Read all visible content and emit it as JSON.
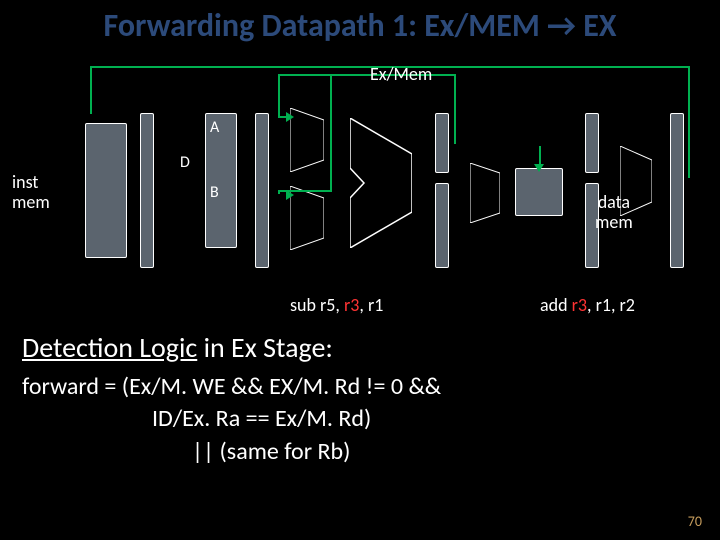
{
  "title": "Forwarding Datapath 1: Ex/MEM → EX",
  "diagram": {
    "exmem_label": "Ex/Mem",
    "inst_mem": "inst\nmem",
    "data_mem": "data\nmem",
    "port_d": "D",
    "port_a": "A",
    "port_b": "B",
    "sub_text": "sub r5, ",
    "sub_rd": "r3",
    "sub_rest": ", r1",
    "add_text": "add ",
    "add_rd": "r3",
    "add_rest": ", r1, r2"
  },
  "detection": {
    "heading_a": "Detection Logic",
    "heading_b": " in Ex Stage:",
    "line1": "forward = (Ex/M. WE && EX/M. Rd != 0 &&",
    "line2": "ID/Ex. Ra == Ex/M. Rd)",
    "line3": "|| (same for Rb)"
  },
  "slide_number": "70"
}
